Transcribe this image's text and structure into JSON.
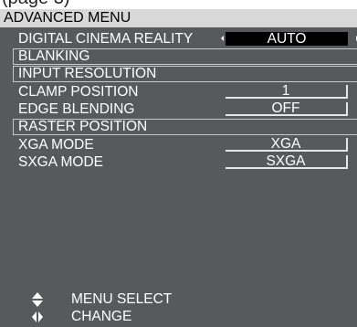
{
  "top_partial_text": "(page 3)",
  "menu": {
    "title": "ADVANCED MENU",
    "items": [
      {
        "label": "DIGITAL CINEMA REALITY",
        "value": "AUTO"
      },
      {
        "label": "BLANKING"
      },
      {
        "label": "INPUT RESOLUTION"
      },
      {
        "label": "CLAMP POSITION",
        "value": "1"
      },
      {
        "label": "EDGE BLENDING",
        "value": "OFF"
      },
      {
        "label": "RASTER POSITION"
      },
      {
        "label": "XGA MODE",
        "value": "XGA"
      },
      {
        "label": "SXGA MODE",
        "value": "SXGA"
      }
    ]
  },
  "hints": {
    "menu_select": {
      "icon": "up-down-arrows-icon",
      "text": "MENU SELECT"
    },
    "change": {
      "icon": "left-right-arrows-icon",
      "text": "CHANGE"
    }
  },
  "colors": {
    "panel": "#58595b",
    "title_bar": "#d8d8d8",
    "selected_value": "#000000",
    "text": "#ffffff"
  }
}
